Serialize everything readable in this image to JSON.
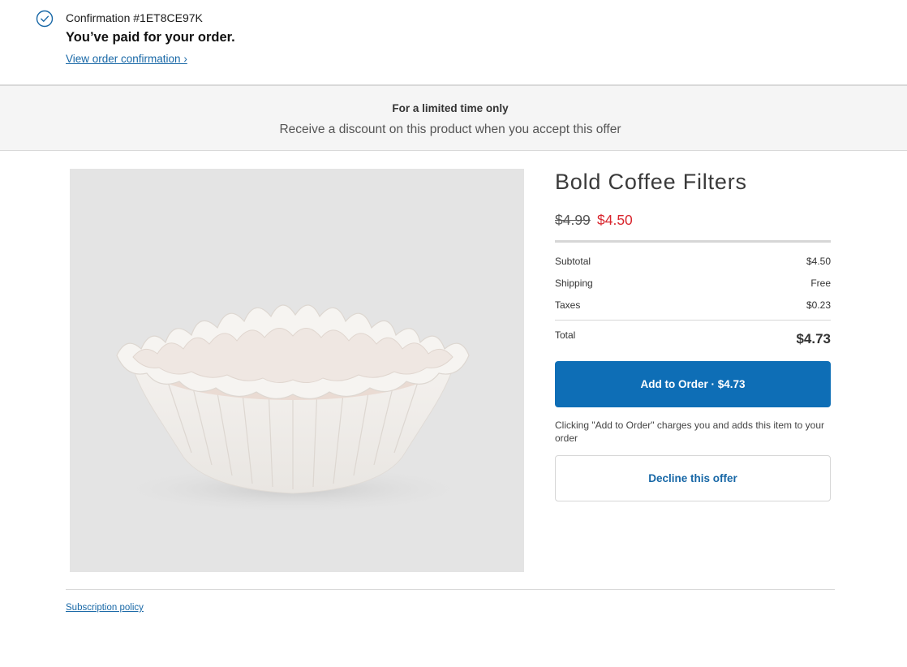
{
  "confirmation": {
    "number": "Confirmation #1ET8CE97K",
    "heading": "You’ve paid for your order.",
    "link": "View order confirmation ›"
  },
  "banner": {
    "title": "For a limited time only",
    "subtitle": "Receive a discount on this product when you accept this offer"
  },
  "product": {
    "title": "Bold Coffee Filters",
    "price_original": "$4.99",
    "price_discounted": "$4.50",
    "image_icon": "coffee-filters-image"
  },
  "summary": {
    "subtotal_label": "Subtotal",
    "subtotal_value": "$4.50",
    "shipping_label": "Shipping",
    "shipping_value": "Free",
    "taxes_label": "Taxes",
    "taxes_value": "$0.23",
    "total_label": "Total",
    "total_value": "$4.73"
  },
  "actions": {
    "add_label": "Add to Order · $4.73",
    "note": "Clicking \"Add to Order\" charges you and adds this item to your order",
    "decline_label": "Decline this offer"
  },
  "footer": {
    "subscription_link": "Subscription policy"
  },
  "colors": {
    "accent": "#0e6eb6",
    "link": "#1767a6",
    "sale_price": "#d9262e",
    "banner_bg": "#f5f5f5"
  }
}
